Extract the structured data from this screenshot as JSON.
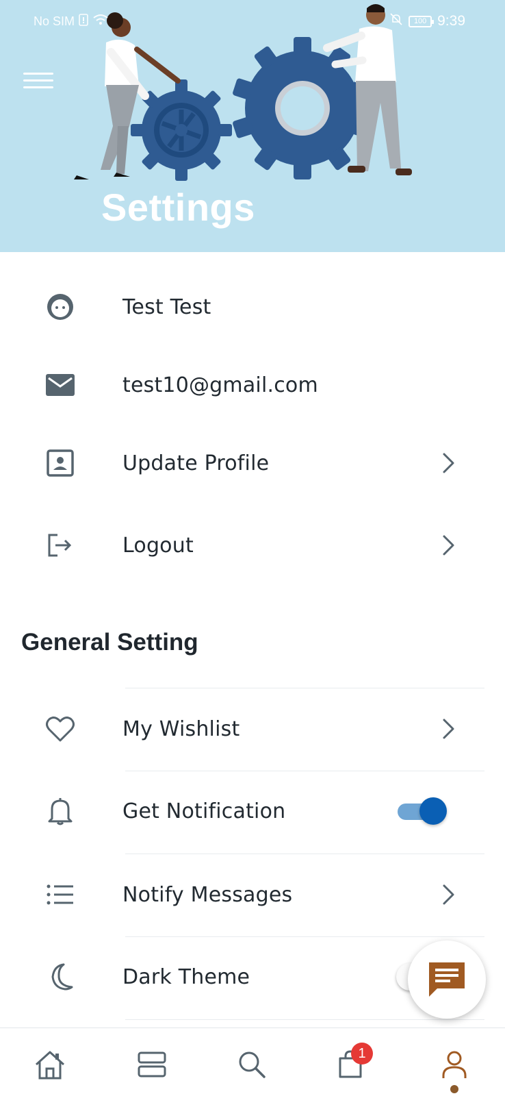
{
  "status_bar": {
    "carrier": "No SIM",
    "battery": "100",
    "time": "9:39"
  },
  "header": {
    "title": "Settings"
  },
  "account": {
    "name": "Test Test",
    "email": "test10@gmail.com",
    "update_profile_label": "Update Profile",
    "logout_label": "Logout"
  },
  "general": {
    "section_title": "General Setting",
    "wishlist_label": "My Wishlist",
    "notification_label": "Get Notification",
    "notification_enabled": true,
    "notify_messages_label": "Notify Messages",
    "dark_theme_label": "Dark Theme",
    "dark_theme_enabled": false
  },
  "bottom_nav": {
    "items": [
      "home-icon",
      "categories-icon",
      "search-icon",
      "cart-icon",
      "account-icon"
    ],
    "active": "account-icon",
    "cart_badge": "1"
  },
  "colors": {
    "banner": "#bde1ef",
    "icon_gray": "#56646e",
    "toggle_on": "#0a5fb4",
    "fab_icon": "#a05a22",
    "badge": "#e53935",
    "active_nav": "#8b5a2b"
  }
}
